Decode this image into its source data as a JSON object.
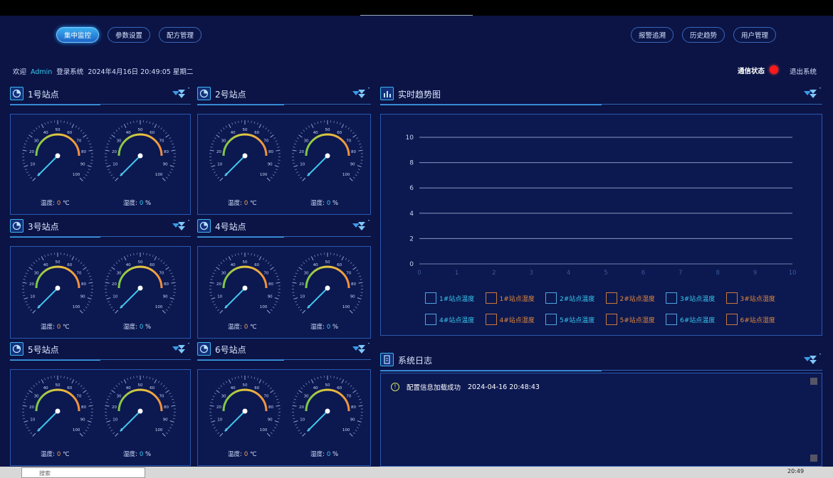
{
  "nav": {
    "left": [
      "集中监控",
      "参数设置",
      "配方管理"
    ],
    "right": [
      "报警追溯",
      "历史趋势",
      "用户管理"
    ]
  },
  "header": {
    "welcome": "欢迎",
    "user": "Admin",
    "login_text": "登录系统",
    "datetime": "2024年4月16日 20:49:05 星期二",
    "comm_status_label": "通信状态",
    "comm_status_color": "#ff1a1a",
    "logout": "退出系统"
  },
  "stations": [
    {
      "title": "1号站点",
      "temp_label": "温度:",
      "temp_value": "0",
      "temp_unit": "℃",
      "hum_label": "湿度:",
      "hum_value": "0",
      "hum_unit": "%"
    },
    {
      "title": "2号站点",
      "temp_label": "温度:",
      "temp_value": "0",
      "temp_unit": "℃",
      "hum_label": "湿度:",
      "hum_value": "0",
      "hum_unit": "%"
    },
    {
      "title": "3号站点",
      "temp_label": "温度:",
      "temp_value": "0",
      "temp_unit": "℃",
      "hum_label": "湿度:",
      "hum_value": "0",
      "hum_unit": "%"
    },
    {
      "title": "4号站点",
      "temp_label": "温度:",
      "temp_value": "0",
      "temp_unit": "℃",
      "hum_label": "湿度:",
      "hum_value": "0",
      "hum_unit": "%"
    },
    {
      "title": "5号站点",
      "temp_label": "温度:",
      "temp_value": "0",
      "temp_unit": "℃",
      "hum_label": "湿度:",
      "hum_value": "0",
      "hum_unit": "%"
    },
    {
      "title": "6号站点",
      "temp_label": "温度:",
      "temp_value": "0",
      "temp_unit": "℃",
      "hum_label": "湿度:",
      "hum_value": "0",
      "hum_unit": "%"
    }
  ],
  "gauge": {
    "min": 0,
    "max": 100,
    "value": 0,
    "ticks": [
      "0",
      "10",
      "20",
      "30",
      "40",
      "50",
      "60",
      "70",
      "80",
      "90",
      "100"
    ]
  },
  "trend": {
    "title": "实时趋势图",
    "legend": [
      "1#站点温度",
      "1#站点湿度",
      "2#站点温度",
      "2#站点湿度",
      "3#站点温度",
      "3#站点湿度",
      "4#站点温度",
      "4#站点湿度",
      "5#站点温度",
      "5#站点湿度",
      "6#站点温度",
      "6#站点湿度"
    ]
  },
  "chart_data": {
    "type": "line",
    "title": "实时趋势图",
    "xlabel": "",
    "ylabel": "",
    "xlim": [
      0,
      10
    ],
    "ylim": [
      0,
      10
    ],
    "x_ticks": [
      0,
      1,
      2,
      3,
      4,
      5,
      6,
      7,
      8,
      9,
      10
    ],
    "y_ticks": [
      0,
      2,
      4,
      6,
      8,
      10
    ],
    "grid": true,
    "series": [
      {
        "name": "1#站点温度",
        "values": []
      },
      {
        "name": "1#站点湿度",
        "values": []
      },
      {
        "name": "2#站点温度",
        "values": []
      },
      {
        "name": "2#站点湿度",
        "values": []
      },
      {
        "name": "3#站点温度",
        "values": []
      },
      {
        "name": "3#站点湿度",
        "values": []
      },
      {
        "name": "4#站点温度",
        "values": []
      },
      {
        "name": "4#站点湿度",
        "values": []
      },
      {
        "name": "5#站点温度",
        "values": []
      },
      {
        "name": "5#站点湿度",
        "values": []
      },
      {
        "name": "6#站点温度",
        "values": []
      },
      {
        "name": "6#站点湿度",
        "values": []
      }
    ],
    "legend_position": "bottom"
  },
  "log": {
    "title": "系统日志",
    "entries": [
      {
        "icon": "!",
        "message": "配置信息加载成功",
        "time": "2024-04-16 20:48:43"
      }
    ]
  },
  "taskbar": {
    "search_placeholder": "搜索",
    "time": "20:49"
  },
  "colors": {
    "bg": "#0b1445",
    "accent": "#38c8f0",
    "temp_value": "#f0a050",
    "hum_value": "#38c8f0",
    "alarm": "#ff1a1a"
  }
}
